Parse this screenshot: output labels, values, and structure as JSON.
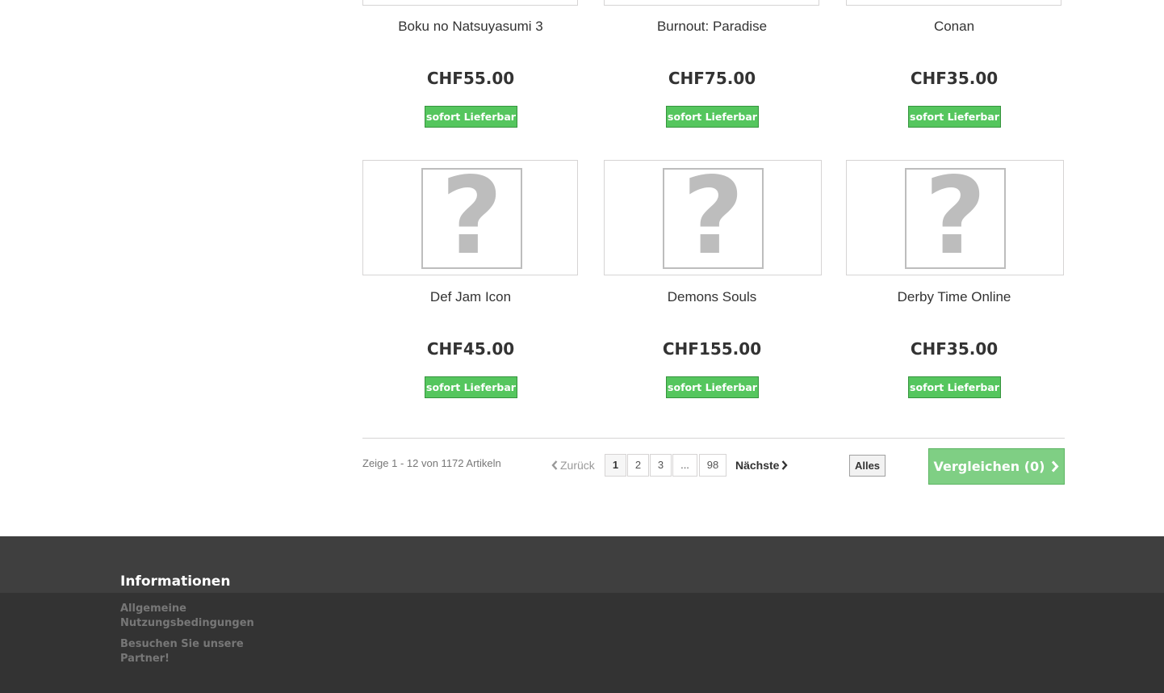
{
  "products": [
    {
      "name": "Boku no Natsuyasumi 3",
      "price": "CHF55.00",
      "availability": "sofort Lieferbar"
    },
    {
      "name": "Burnout: Paradise",
      "price": "CHF75.00",
      "availability": "sofort Lieferbar"
    },
    {
      "name": "Conan",
      "price": "CHF35.00",
      "availability": "sofort Lieferbar"
    },
    {
      "name": "Def Jam Icon",
      "price": "CHF45.00",
      "availability": "sofort Lieferbar"
    },
    {
      "name": "Demons Souls",
      "price": "CHF155.00",
      "availability": "sofort Lieferbar"
    },
    {
      "name": "Derby Time Online",
      "price": "CHF35.00",
      "availability": "sofort Lieferbar"
    }
  ],
  "placeholder_glyph": "?",
  "pagination": {
    "count_text": "Zeige 1 - 12 von 1172 Artikeln",
    "prev_label": "Zurück",
    "next_label": "Nächste",
    "pages": [
      "1",
      "2",
      "3",
      "...",
      "98"
    ],
    "current_page": "1",
    "show_all_label": "Alles",
    "compare_label": "Vergleichen (0)"
  },
  "footer": {
    "title": "Informationen",
    "links": [
      "Allgemeine Nutzungsbedingungen",
      "Besuchen Sie unsere Partner!"
    ]
  },
  "colors": {
    "availability_green": "#55c65e",
    "compare_green": "#7fcf84",
    "footer_dark": "#333333",
    "footer_band": "#3f3f3f"
  },
  "icons": {
    "prev": "chevron-left-icon",
    "next": "chevron-right-icon",
    "compare": "chevron-right-icon"
  }
}
